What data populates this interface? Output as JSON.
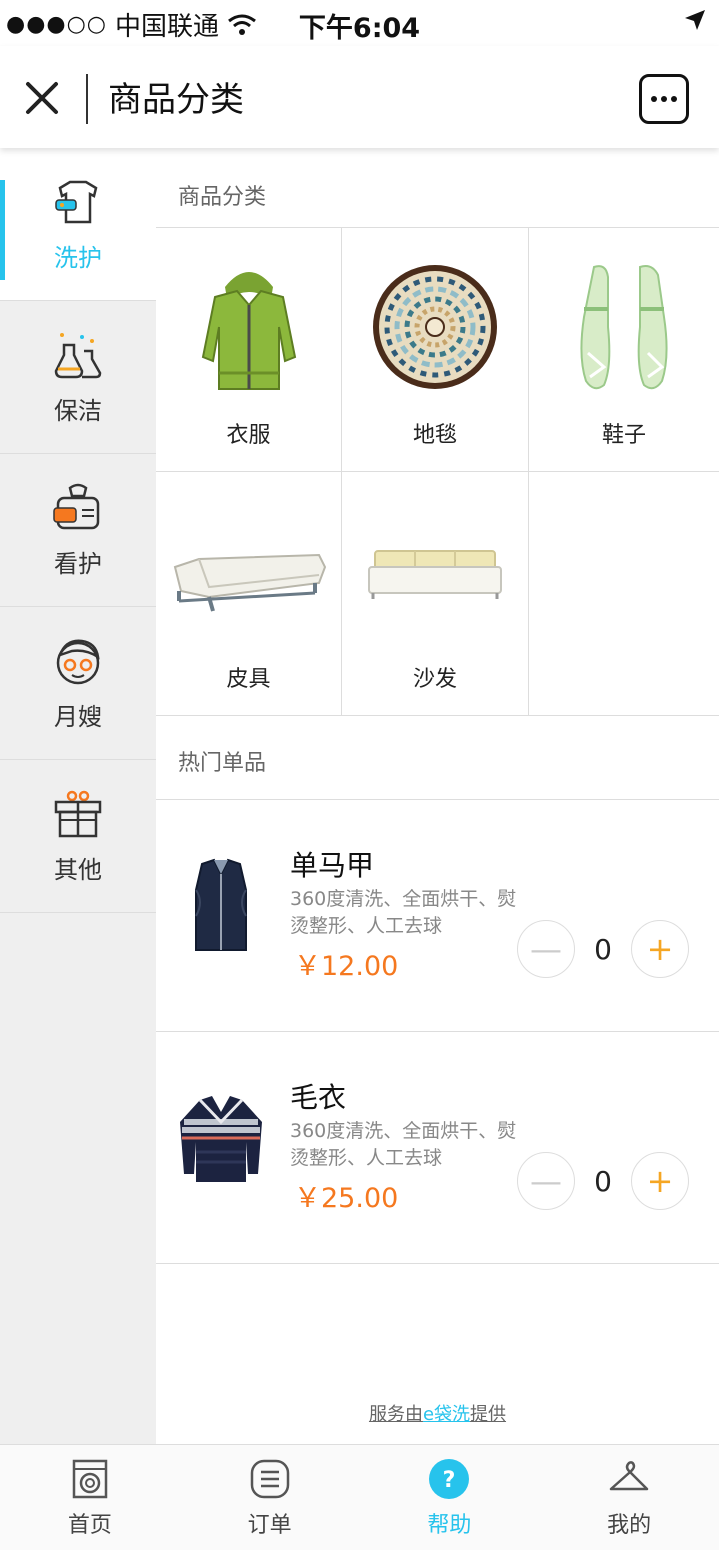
{
  "status": {
    "signal_dots": "●●●○○",
    "carrier": "中国联通",
    "time": "下午6:04"
  },
  "nav": {
    "title": "商品分类"
  },
  "sidebar": {
    "items": [
      {
        "label": "洗护",
        "icon": "laundry-tshirt-icon",
        "active": true
      },
      {
        "label": "保洁",
        "icon": "cleaning-flask-icon",
        "active": false
      },
      {
        "label": "看护",
        "icon": "care-basket-icon",
        "active": false
      },
      {
        "label": "月嫂",
        "icon": "nanny-face-icon",
        "active": false
      },
      {
        "label": "其他",
        "icon": "gift-box-icon",
        "active": false
      }
    ]
  },
  "categories": {
    "title": "商品分类",
    "items": [
      {
        "label": "衣服",
        "icon": "jacket-image"
      },
      {
        "label": "地毯",
        "icon": "rug-image"
      },
      {
        "label": "鞋子",
        "icon": "shoes-image"
      },
      {
        "label": "皮具",
        "icon": "leather-sofa-image"
      },
      {
        "label": "沙发",
        "icon": "sofa-image"
      }
    ]
  },
  "hot": {
    "title": "热门单品",
    "products": [
      {
        "name": "单马甲",
        "desc": "360度清洗、全面烘干、熨烫整形、人工去球",
        "price": "￥12.00",
        "qty": "0"
      },
      {
        "name": "毛衣",
        "desc": "360度清洗、全面烘干、熨烫整形、人工去球",
        "price": "￥25.00",
        "qty": "0"
      }
    ]
  },
  "footer": {
    "prefix": "服务由",
    "brand": "e袋洗",
    "suffix": "提供"
  },
  "tabbar": {
    "items": [
      {
        "label": "首页",
        "icon": "washing-machine-icon",
        "active": false
      },
      {
        "label": "订单",
        "icon": "list-icon",
        "active": false
      },
      {
        "label": "帮助",
        "icon": "help-icon",
        "active": true
      },
      {
        "label": "我的",
        "icon": "hanger-icon",
        "active": false
      }
    ]
  },
  "colors": {
    "accent": "#27c3ec",
    "price": "#f5781f",
    "plus": "#f5a623"
  }
}
